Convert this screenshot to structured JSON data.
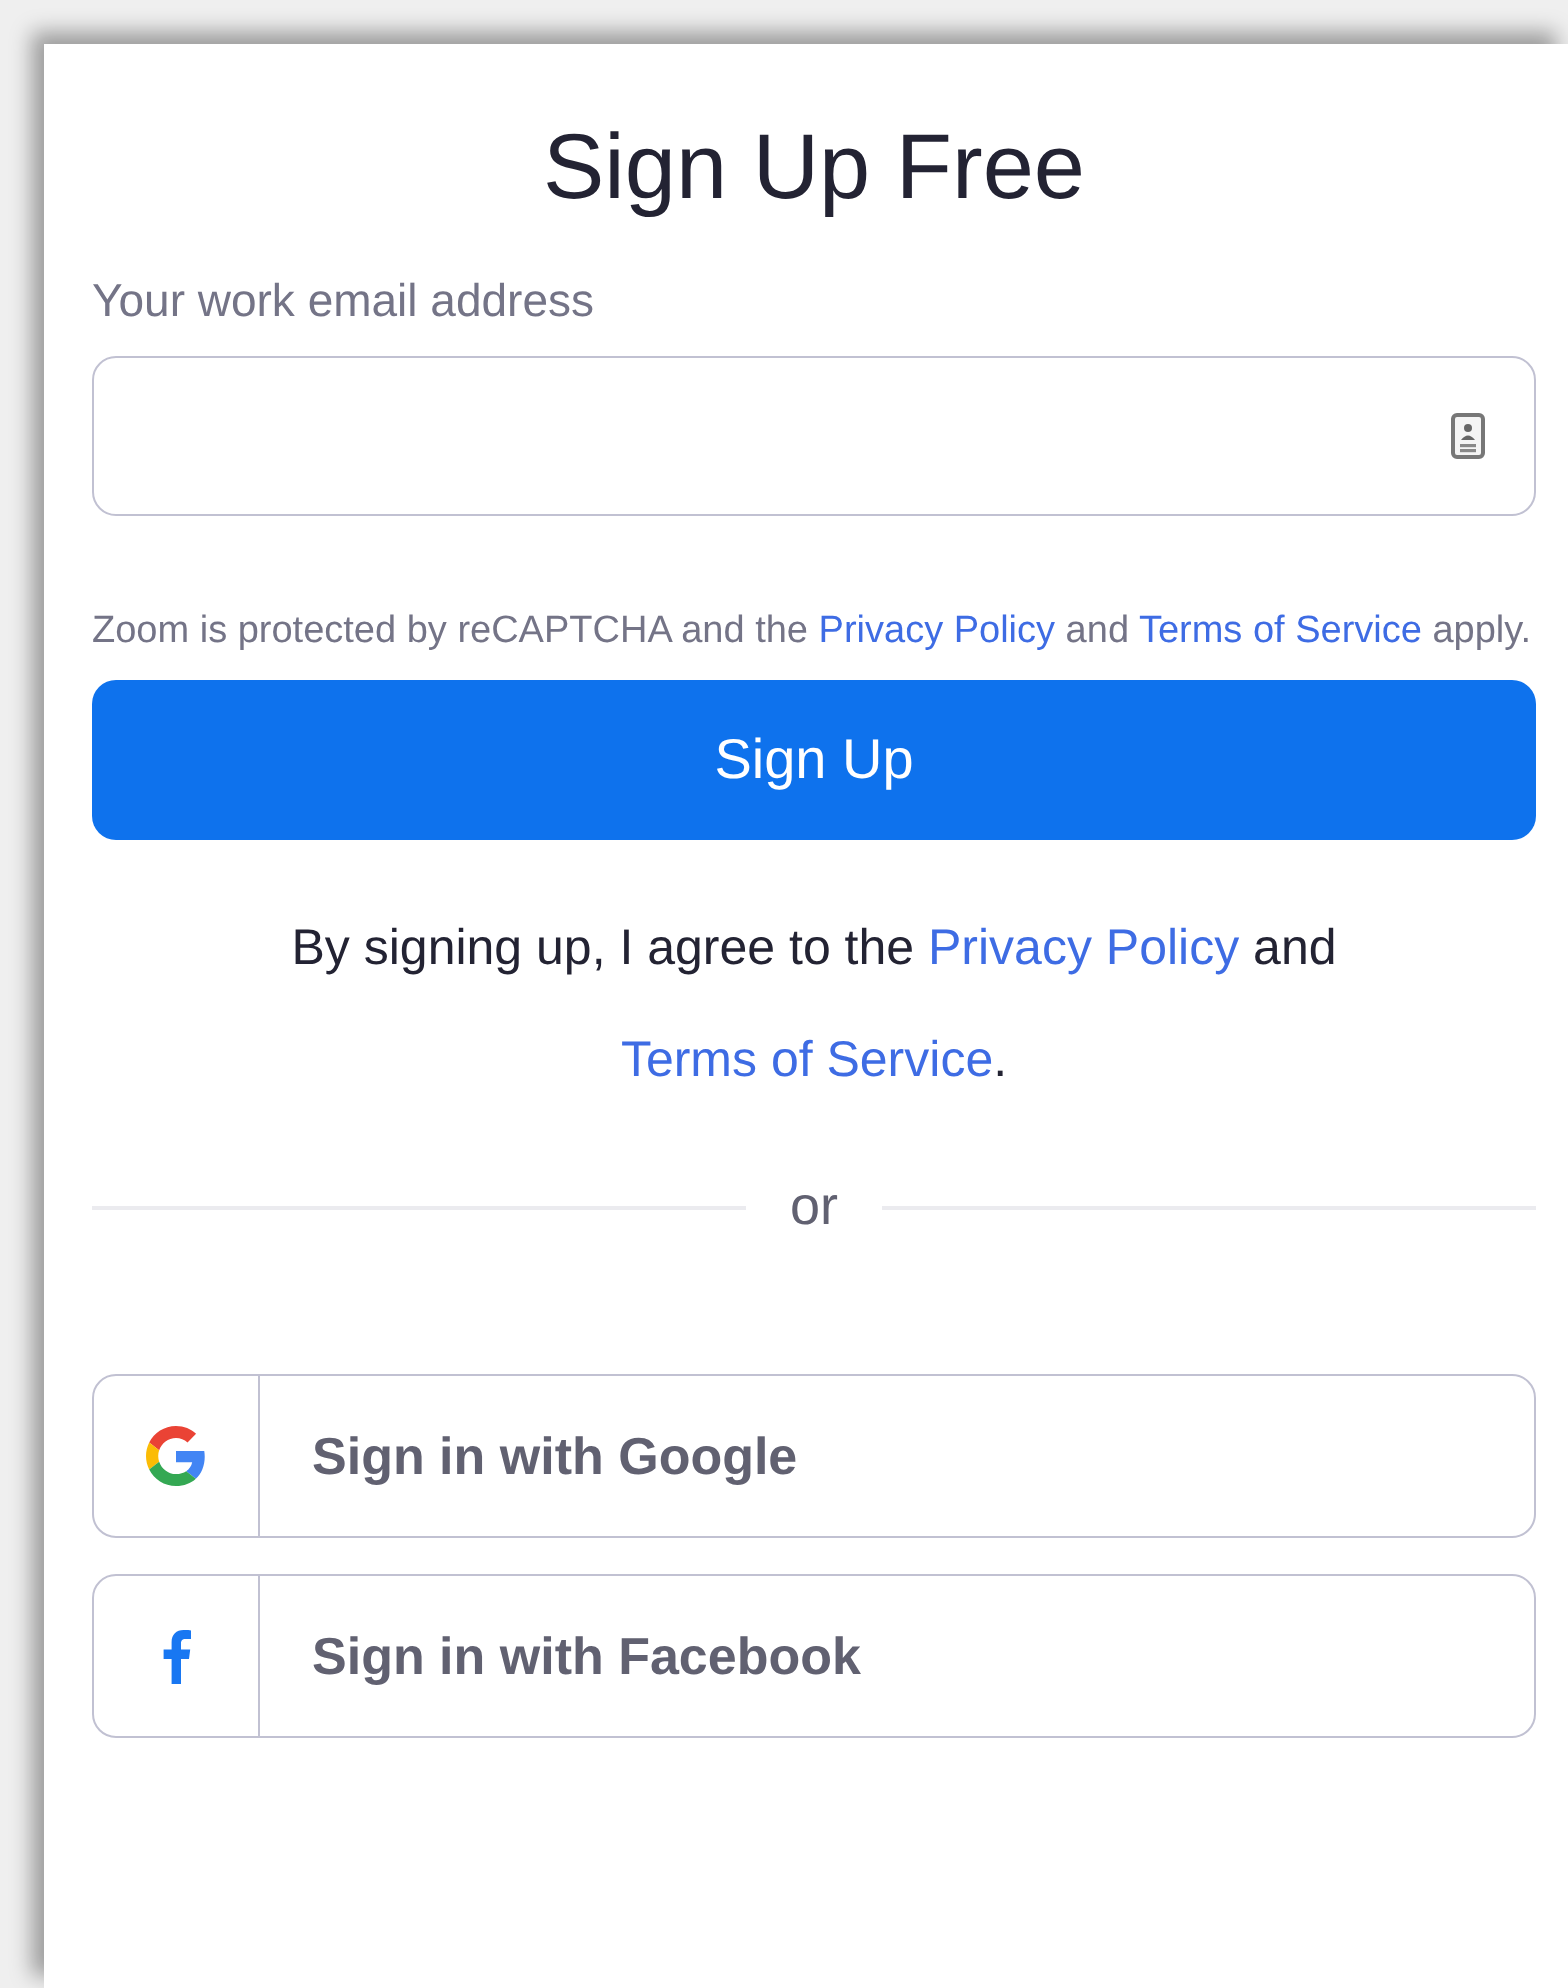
{
  "title": "Sign Up Free",
  "email_field": {
    "label": "Your work email address"
  },
  "recaptcha_notice": [
    {
      "kind": "text",
      "text": "Zoom is protected by reCAPTCHA and the "
    },
    {
      "kind": "link",
      "text": "Privacy Policy"
    },
    {
      "kind": "text",
      "text": " and "
    },
    {
      "kind": "link",
      "text": "Terms of Service"
    },
    {
      "kind": "text",
      "text": " apply."
    }
  ],
  "signup_button": "Sign Up",
  "agreement": [
    {
      "kind": "text",
      "text": "By signing up, I agree to the "
    },
    {
      "kind": "link",
      "text": "Privacy Policy"
    },
    {
      "kind": "text",
      "text": " and "
    },
    {
      "kind": "link",
      "text": "Terms of Service"
    },
    {
      "kind": "text",
      "text": "."
    }
  ],
  "divider_text": "or",
  "social_buttons": [
    {
      "kind": "google",
      "label": "Sign in with Google"
    },
    {
      "kind": "facebook",
      "label": "Sign in with Facebook"
    }
  ]
}
